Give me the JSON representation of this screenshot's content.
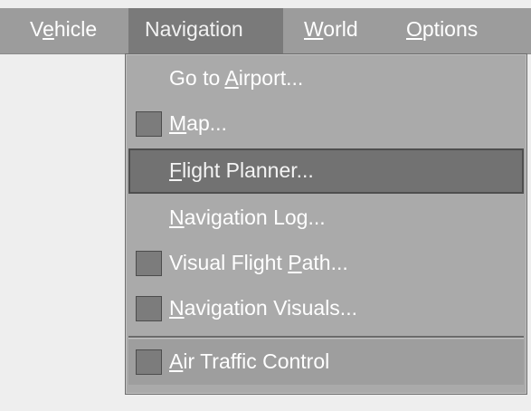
{
  "menubar": {
    "items": [
      {
        "pre": "V",
        "key": "e",
        "post": "hicle",
        "active": false
      },
      {
        "pre": "Navi",
        "key": "g",
        "post": "ation",
        "active": true
      },
      {
        "pre": "",
        "key": "W",
        "post": "orld",
        "active": false
      },
      {
        "pre": "",
        "key": "O",
        "post": "ptions",
        "active": false
      }
    ]
  },
  "dropdown": {
    "items": [
      {
        "pre": "Go to ",
        "key": "A",
        "post": "irport...",
        "checkbox": false,
        "highlighted": false
      },
      {
        "pre": "",
        "key": "M",
        "post": "ap...",
        "checkbox": true,
        "highlighted": false
      },
      {
        "pre": "",
        "key": "F",
        "post": "light Planner...",
        "checkbox": false,
        "highlighted": true
      },
      {
        "pre": "",
        "key": "N",
        "post": "avigation Log...",
        "checkbox": false,
        "highlighted": false
      },
      {
        "pre": "Visual Flight ",
        "key": "P",
        "post": "ath...",
        "checkbox": true,
        "highlighted": false
      },
      {
        "pre": "",
        "key": "N",
        "post": "avigation Visuals...",
        "checkbox": true,
        "highlighted": false
      },
      {
        "pre": "",
        "key": "A",
        "post": "ir Traffic Control",
        "checkbox": true,
        "highlighted": false
      }
    ]
  }
}
